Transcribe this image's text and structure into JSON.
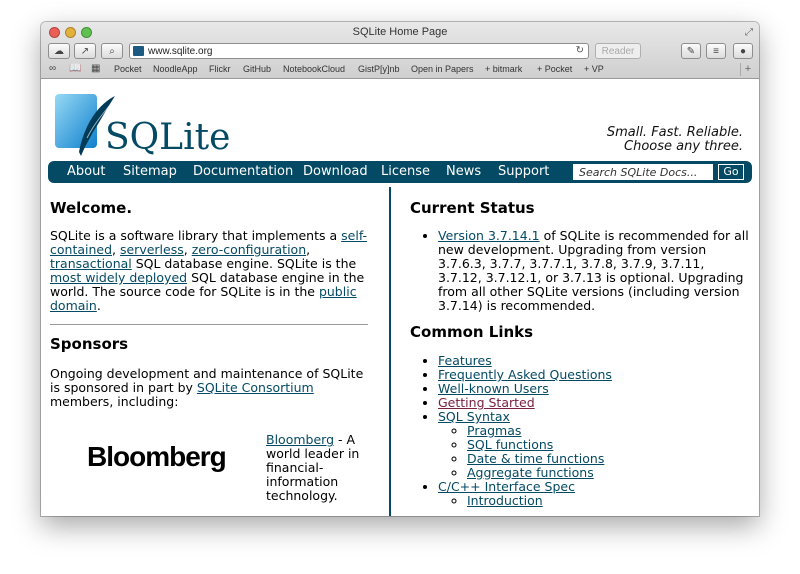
{
  "window": {
    "title": "SQLite Home Page",
    "url": "www.sqlite.org",
    "reader_label": "Reader",
    "bookmarks": [
      "Pocket",
      "NoodleApp",
      "Flickr",
      "GitHub",
      "NotebookCloud",
      "GistP[y]nb",
      "Open in Papers",
      "+ bitmark",
      "+ Pocket",
      "+ VP"
    ]
  },
  "header": {
    "logo_text": "SQLite",
    "tagline_1": "Small. Fast. Reliable.",
    "tagline_2": "Choose any three."
  },
  "nav": {
    "items": [
      "About",
      "Sitemap",
      "Documentation",
      "Download",
      "License",
      "News",
      "Support"
    ],
    "search_placeholder": "Search SQLite Docs...",
    "go_label": "Go"
  },
  "welcome": {
    "title": "Welcome.",
    "t1": "SQLite is a software library that implements a ",
    "l_selfcontained": "self-contained",
    "t2": ", ",
    "l_serverless": "serverless",
    "t3": ", ",
    "l_zeroconf": "zero-configuration",
    "t4": ", ",
    "l_transactional": "transactional",
    "t5": " SQL database engine. SQLite is the ",
    "l_widely": "most widely deployed",
    "t6": " SQL database engine in the world. The source code for SQLite is in the ",
    "l_public": "public domain",
    "t7": "."
  },
  "sponsors": {
    "title": "Sponsors",
    "t1": "Ongoing development and maintenance of SQLite is sponsored in part by ",
    "l_consortium": "SQLite Consortium",
    "t2": " members, including:",
    "bloomberg_logo": "Bloomberg",
    "bloomberg_link": "Bloomberg",
    "bloomberg_desc": " - A world leader in financial-information technology."
  },
  "status": {
    "title": "Current Status",
    "l_version": "Version 3.7.14.1",
    "text": " of SQLite is recommended for all new development. Upgrading from version 3.7.6.3, 3.7.7, 3.7.7.1, 3.7.8, 3.7.9, 3.7.11, 3.7.12, 3.7.12.1, or 3.7.13 is optional. Upgrading from all other SQLite versions (including version 3.7.14) is recommended."
  },
  "common_links": {
    "title": "Common Links",
    "features": "Features",
    "faq": "Frequently Asked Questions",
    "users": "Well-known Users",
    "getting_started": "Getting Started",
    "sql_syntax": "SQL Syntax",
    "pragmas": "Pragmas",
    "sql_functions": "SQL functions",
    "datetime": "Date & time functions",
    "aggregate": "Aggregate functions",
    "capi": "C/C++ Interface Spec",
    "intro": "Introduction"
  },
  "colors": {
    "nav_bg": "#044a64",
    "link": "#044a64",
    "visited_link": "#7a2141"
  }
}
